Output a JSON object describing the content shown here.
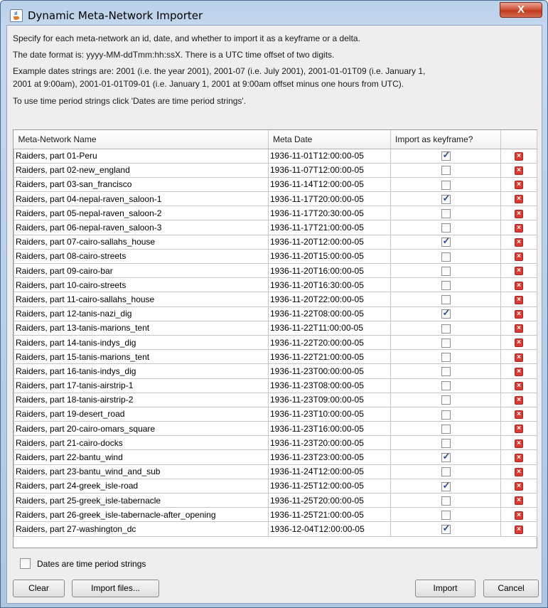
{
  "window": {
    "title": "Dynamic Meta-Network Importer",
    "close_label": "X"
  },
  "description": {
    "line1": "Specify for each meta-network an id, date, and whether to import it as a keyframe or a delta.",
    "line2": "The date format is: yyyy-MM-ddTmm:hh:ssX. There is a UTC time offset of two digits.",
    "line3a": "Example dates strings are: 2001 (i.e. the year 2001), 2001-07 (i.e. July 2001), 2001-01-01T09 (i.e. January 1,",
    "line3b": "2001 at 9:00am), 2001-01-01T09-01 (i.e. January 1, 2001 at 9:00am offset minus one hours from UTC).",
    "line4": "To use time period strings click 'Dates are time period strings'."
  },
  "table": {
    "columns": [
      "Meta-Network Name",
      "Meta Date",
      "Import as keyframe?",
      ""
    ],
    "rows": [
      {
        "name": "Raiders, part 01-Peru",
        "date": "1936-11-01T12:00:00-05",
        "keyframe": true
      },
      {
        "name": "Raiders, part 02-new_england",
        "date": "1936-11-07T12:00:00-05",
        "keyframe": false
      },
      {
        "name": "Raiders, part 03-san_francisco",
        "date": "1936-11-14T12:00:00-05",
        "keyframe": false
      },
      {
        "name": "Raiders, part 04-nepal-raven_saloon-1",
        "date": "1936-11-17T20:00:00-05",
        "keyframe": true
      },
      {
        "name": "Raiders, part 05-nepal-raven_saloon-2",
        "date": "1936-11-17T20:30:00-05",
        "keyframe": false
      },
      {
        "name": "Raiders, part 06-nepal-raven_saloon-3",
        "date": "1936-11-17T21:00:00-05",
        "keyframe": false
      },
      {
        "name": "Raiders, part 07-cairo-sallahs_house",
        "date": "1936-11-20T12:00:00-05",
        "keyframe": true
      },
      {
        "name": "Raiders, part 08-cairo-streets",
        "date": "1936-11-20T15:00:00-05",
        "keyframe": false
      },
      {
        "name": "Raiders, part 09-cairo-bar",
        "date": "1936-11-20T16:00:00-05",
        "keyframe": false
      },
      {
        "name": "Raiders, part 10-cairo-streets",
        "date": "1936-11-20T16:30:00-05",
        "keyframe": false
      },
      {
        "name": "Raiders, part 11-cairo-sallahs_house",
        "date": "1936-11-20T22:00:00-05",
        "keyframe": false
      },
      {
        "name": "Raiders, part 12-tanis-nazi_dig",
        "date": "1936-11-22T08:00:00-05",
        "keyframe": true
      },
      {
        "name": "Raiders, part 13-tanis-marions_tent",
        "date": "1936-11-22T11:00:00-05",
        "keyframe": false
      },
      {
        "name": "Raiders, part 14-tanis-indys_dig",
        "date": "1936-11-22T20:00:00-05",
        "keyframe": false
      },
      {
        "name": "Raiders, part 15-tanis-marions_tent",
        "date": "1936-11-22T21:00:00-05",
        "keyframe": false
      },
      {
        "name": "Raiders, part 16-tanis-indys_dig",
        "date": "1936-11-23T00:00:00-05",
        "keyframe": false
      },
      {
        "name": "Raiders, part 17-tanis-airstrip-1",
        "date": "1936-11-23T08:00:00-05",
        "keyframe": false
      },
      {
        "name": "Raiders, part 18-tanis-airstrip-2",
        "date": "1936-11-23T09:00:00-05",
        "keyframe": false
      },
      {
        "name": "Raiders, part 19-desert_road",
        "date": "1936-11-23T10:00:00-05",
        "keyframe": false
      },
      {
        "name": "Raiders, part 20-cairo-omars_square",
        "date": "1936-11-23T16:00:00-05",
        "keyframe": false
      },
      {
        "name": "Raiders, part 21-cairo-docks",
        "date": "1936-11-23T20:00:00-05",
        "keyframe": false
      },
      {
        "name": "Raiders, part 22-bantu_wind",
        "date": "1936-11-23T23:00:00-05",
        "keyframe": true
      },
      {
        "name": "Raiders, part 23-bantu_wind_and_sub",
        "date": "1936-11-24T12:00:00-05",
        "keyframe": false
      },
      {
        "name": "Raiders, part 24-greek_isle-road",
        "date": "1936-11-25T12:00:00-05",
        "keyframe": true
      },
      {
        "name": "Raiders, part 25-greek_isle-tabernacle",
        "date": "1936-11-25T20:00:00-05",
        "keyframe": false
      },
      {
        "name": "Raiders, part 26-greek_isle-tabernacle-after_opening",
        "date": "1936-11-25T21:00:00-05",
        "keyframe": false
      },
      {
        "name": "Raiders, part 27-washington_dc",
        "date": "1936-12-04T12:00:00-05",
        "keyframe": true
      }
    ]
  },
  "footer": {
    "time_period_label": "Dates are time period strings",
    "time_period_checked": false,
    "clear_label": "Clear",
    "import_files_label": "Import files...",
    "import_label": "Import",
    "cancel_label": "Cancel"
  },
  "icons": {
    "app": "java-coffee-icon",
    "delete": "delete-row-icon"
  }
}
